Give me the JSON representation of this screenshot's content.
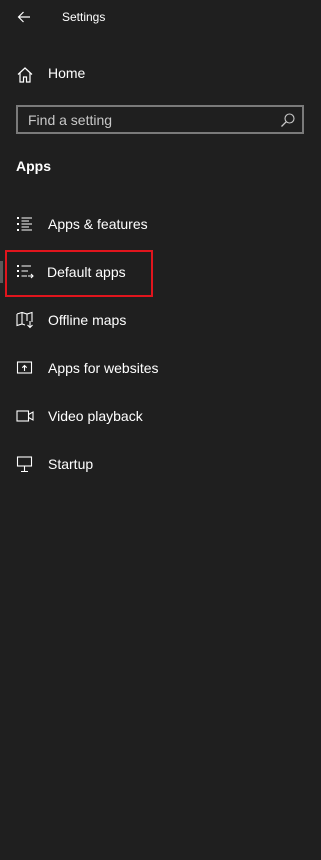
{
  "window": {
    "title": "Settings"
  },
  "home": {
    "label": "Home",
    "icon": "home-icon"
  },
  "search": {
    "placeholder": "Find a setting",
    "value": "",
    "icon": "search-icon"
  },
  "section": {
    "title": "Apps"
  },
  "nav": {
    "items": [
      {
        "label": "Apps & features",
        "icon": "apps-features-icon",
        "selected": false
      },
      {
        "label": "Default apps",
        "icon": "default-apps-icon",
        "selected": true
      },
      {
        "label": "Offline maps",
        "icon": "offline-maps-icon",
        "selected": false
      },
      {
        "label": "Apps for websites",
        "icon": "apps-for-websites-icon",
        "selected": false
      },
      {
        "label": "Video playback",
        "icon": "video-playback-icon",
        "selected": false
      },
      {
        "label": "Startup",
        "icon": "startup-icon",
        "selected": false
      }
    ]
  },
  "colors": {
    "background": "#1f1f1f",
    "text": "#ffffff",
    "highlight": "#e0151d",
    "selection_indicator": "#5a5a5a",
    "search_border": "#7a7a7a"
  }
}
